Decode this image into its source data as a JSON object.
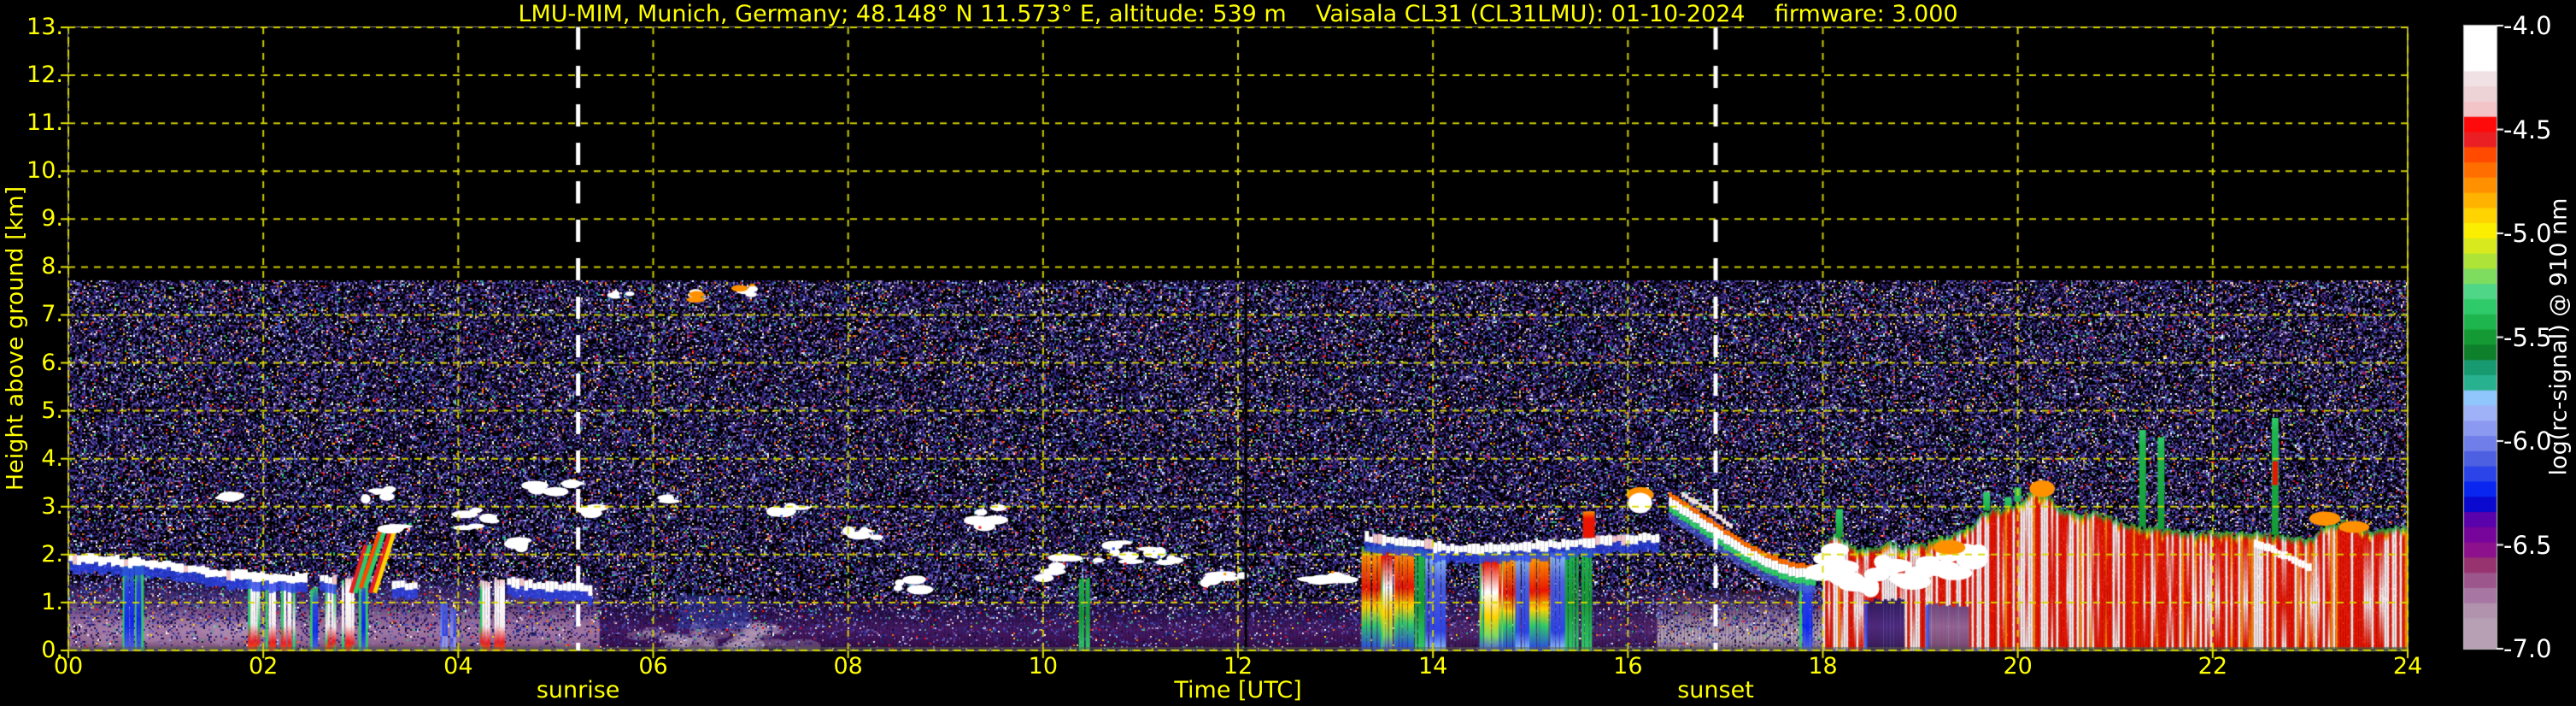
{
  "header": {
    "title": "LMU-MIM, Munich, Germany; 48.148° N 11.573° E, altitude: 539 m    Vaisala CL31 (CL31LMU): 01-10-2024    firmware: 3.000"
  },
  "chart_data": {
    "type": "heatmap",
    "title": "LMU-MIM, Munich, Germany; 48.148° N 11.573° E, altitude: 539 m    Vaisala CL31 (CL31LMU): 01-10-2024    firmware: 3.000",
    "xlabel": "Time [UTC]",
    "ylabel": "Height above ground [km]",
    "xlim": [
      0,
      24
    ],
    "ylim": [
      0,
      13
    ],
    "xticks": {
      "values": [
        0,
        2,
        4,
        6,
        8,
        10,
        12,
        14,
        16,
        18,
        20,
        22,
        24
      ],
      "labels": [
        "00",
        "02",
        "04",
        "06",
        "08",
        "10",
        "12",
        "14",
        "16",
        "18",
        "20",
        "22",
        "24"
      ]
    },
    "yticks": {
      "values": [
        0,
        1,
        2,
        3,
        4,
        5,
        6,
        7,
        8,
        9,
        10,
        11,
        12,
        13
      ],
      "labels": [
        "0.",
        "1.",
        "2.",
        "3.",
        "4.",
        "5.",
        "6.",
        "7.",
        "8.",
        "9.",
        "10.",
        "11.",
        "12.",
        "13."
      ]
    },
    "grid": {
      "color": "#d8d800",
      "style": "dashed",
      "x_interval_h": 2,
      "y_interval_km": 1,
      "above_data": true
    },
    "colorbar": {
      "label": "log(rc-signal) @ 910 nm",
      "min": -7.0,
      "max": -4.0,
      "ticks": [
        -4.0,
        -4.5,
        -5.0,
        -5.5,
        -6.0,
        -6.5,
        -7.0
      ],
      "tick_labels": [
        "-4.0",
        "-4.5",
        "-5.0",
        "-5.5",
        "-6.0",
        "-6.5",
        "-7.0"
      ],
      "palette_top_to_bottom": [
        "#ffffff",
        "#ffffff",
        "#ffffff",
        "#f0e2e4",
        "#eed3d6",
        "#f2c4c8",
        "#ff0a0a",
        "#ea1f24",
        "#ff4a00",
        "#ff6f00",
        "#ff9100",
        "#ffb300",
        "#ffd400",
        "#fcee00",
        "#d8ea1e",
        "#aee437",
        "#7edd5f",
        "#4fd687",
        "#2fca69",
        "#1fb54e",
        "#149a35",
        "#0e7f2b",
        "#189a70",
        "#28b18f",
        "#8fc6fb",
        "#9fb2f7",
        "#8c99f1",
        "#707ee9",
        "#4c60e1",
        "#2b44ea",
        "#0826f0",
        "#0909cf",
        "#5a02ab",
        "#77059b",
        "#8d108d",
        "#97336f",
        "#9c568b",
        "#a876a2",
        "#b193ae",
        "#b7a0b4",
        "#b7a0b4"
      ]
    },
    "sun": {
      "sunrise_label": "sunrise",
      "sunrise_utc": 5.23,
      "sunset_label": "sunset",
      "sunset_utc": 16.9,
      "line_color": "#ffffff"
    },
    "max_range_km": 7.72,
    "noise": {
      "dark": [
        "#1b0f3a",
        "#241457",
        "#2c1a6e",
        "#201046",
        "#35206e",
        "#3a1b5e",
        "#13082b",
        "#2a2a8a",
        "#1e2a7a",
        "#303a9e",
        "#4a2a8e",
        "#503a9a"
      ],
      "mid": [
        "#5560c0",
        "#6a4a9a",
        "#7a5aa6",
        "#4455bb",
        "#8f7ab0",
        "#9a86b8"
      ],
      "bright": [
        "#ffffff",
        "#f2c4c8",
        "#ff6f00",
        "#ffd400",
        "#2fca69",
        "#8fc6fb",
        "#ff0a0a",
        "#28b18f",
        "#9fb2f7",
        "#e8e8e8"
      ],
      "p_black": 0.42,
      "p_dark": 0.38,
      "p_mid": 0.13,
      "p_bright": 0.07
    },
    "regions": [
      {
        "t0": 0.0,
        "t1": 5.45,
        "stops": [
          [
            1.45,
            "#160a2e"
          ],
          [
            1.05,
            "#52356a"
          ],
          [
            0.7,
            "#8a5f8e"
          ],
          [
            0.4,
            "#a277a2"
          ],
          [
            0.15,
            "#8f648f"
          ],
          [
            0.0,
            "#5f3f63"
          ]
        ]
      },
      {
        "t0": 5.45,
        "t1": 13.25,
        "stops": [
          [
            1.1,
            "#130724"
          ],
          [
            0.75,
            "#2c1048"
          ],
          [
            0.45,
            "#471a62"
          ],
          [
            0.18,
            "#3c1254"
          ],
          [
            0.0,
            "#2a0c3e"
          ]
        ]
      },
      {
        "t0": 13.25,
        "t1": 16.3,
        "stops": [
          [
            1.3,
            "#150a28"
          ],
          [
            0.8,
            "#3a1a55"
          ],
          [
            0.4,
            "#55276e"
          ],
          [
            0.0,
            "#331048"
          ]
        ]
      },
      {
        "t0": 16.3,
        "t1": 18.0,
        "stops": [
          [
            1.25,
            "#241430"
          ],
          [
            0.9,
            "#6a4a70"
          ],
          [
            0.55,
            "#a28ba4"
          ],
          [
            0.25,
            "#b5a2b4"
          ],
          [
            0.08,
            "#8a6f8c"
          ],
          [
            0.0,
            "#5a3f5e"
          ]
        ]
      }
    ],
    "haze_patches": [
      {
        "t0": 5.8,
        "t1": 7.6,
        "h0": 0.08,
        "h1": 0.45,
        "color": "#c0abc0",
        "alpha": 0.5
      },
      {
        "t0": 0.1,
        "t1": 1.9,
        "h0": 0.2,
        "h1": 0.55,
        "color": "#b897b8",
        "alpha": 0.35
      }
    ],
    "blue_patches": [
      {
        "t0": 6.25,
        "t1": 7.0,
        "h0": 0.45,
        "h1": 1.15,
        "color": "#3050c8",
        "alpha": 0.45
      }
    ],
    "bl_lines": [
      {
        "points": [
          [
            0,
            1.93
          ],
          [
            0.35,
            1.88
          ],
          [
            0.7,
            1.83
          ],
          [
            1.0,
            1.78
          ],
          [
            1.3,
            1.68
          ],
          [
            1.6,
            1.6
          ],
          [
            1.85,
            1.56
          ],
          [
            2.05,
            1.52
          ],
          [
            2.3,
            1.5
          ],
          [
            2.45,
            1.5
          ]
        ]
      },
      {
        "points": [
          [
            2.58,
            1.5
          ],
          [
            2.75,
            1.48
          ]
        ]
      },
      {
        "points": [
          [
            3.32,
            1.38
          ],
          [
            3.55,
            1.33
          ]
        ]
      },
      {
        "points": [
          [
            4.5,
            1.42
          ],
          [
            4.7,
            1.38
          ],
          [
            4.95,
            1.34
          ],
          [
            5.2,
            1.3
          ],
          [
            5.35,
            1.28
          ]
        ]
      },
      {
        "points": [
          [
            13.3,
            2.35
          ],
          [
            13.6,
            2.28
          ],
          [
            13.9,
            2.2
          ],
          [
            14.2,
            2.12
          ],
          [
            14.5,
            2.1
          ],
          [
            14.8,
            2.15
          ],
          [
            15.1,
            2.2
          ],
          [
            15.4,
            2.22
          ],
          [
            15.7,
            2.3
          ],
          [
            16.0,
            2.33
          ],
          [
            16.3,
            2.35
          ]
        ]
      }
    ],
    "clouds": [
      {
        "t0": 1.6,
        "t1": 1.75,
        "h0": 3.05,
        "h1": 3.25
      },
      {
        "t0": 2.9,
        "t1": 3.3,
        "h0": 2.9,
        "h1": 3.4
      },
      {
        "t0": 3.3,
        "t1": 3.45,
        "h0": 2.5,
        "h1": 2.65
      },
      {
        "t0": 4.0,
        "t1": 4.4,
        "h0": 2.5,
        "h1": 3.0
      },
      {
        "t0": 4.55,
        "t1": 4.65,
        "h0": 2.15,
        "h1": 2.3
      },
      {
        "t0": 4.75,
        "t1": 5.2,
        "h0": 3.25,
        "h1": 3.5
      },
      {
        "t0": 5.3,
        "t1": 5.45,
        "h0": 2.85,
        "h1": 3.0
      },
      {
        "t0": 6.1,
        "t1": 6.18,
        "h0": 3.1,
        "h1": 3.2
      },
      {
        "t0": 7.2,
        "t1": 7.5,
        "h0": 2.85,
        "h1": 3.0
      },
      {
        "t0": 8.0,
        "t1": 8.3,
        "h0": 2.3,
        "h1": 2.55
      },
      {
        "t0": 8.5,
        "t1": 8.8,
        "h0": 1.25,
        "h1": 1.5
      },
      {
        "t0": 9.3,
        "t1": 9.6,
        "h0": 2.55,
        "h1": 3.0
      },
      {
        "t0": 10.0,
        "t1": 10.3,
        "h0": 1.5,
        "h1": 1.95
      },
      {
        "t0": 10.55,
        "t1": 11.4,
        "h0": 1.8,
        "h1": 2.25
      },
      {
        "t0": 11.6,
        "t1": 12.1,
        "h0": 1.4,
        "h1": 1.65
      },
      {
        "t0": 12.6,
        "t1": 13.1,
        "h0": 1.45,
        "h1": 1.6
      }
    ],
    "high_specks": [
      {
        "t0": 5.55,
        "t1": 5.78,
        "h": 7.45
      },
      {
        "t0": 6.4,
        "t1": 6.45,
        "h": 7.4
      },
      {
        "t0": 6.88,
        "t1": 7.12,
        "h": 7.5
      }
    ],
    "showers": [
      {
        "t": 0.62,
        "w": 16,
        "top": 1.85,
        "style": "gb"
      },
      {
        "t": 0.72,
        "w": 10,
        "top": 1.8,
        "style": "gb"
      },
      {
        "t": 1.9,
        "w": 14,
        "top": 1.55,
        "style": "wr"
      },
      {
        "t": 2.08,
        "w": 12,
        "top": 1.5,
        "style": "wr"
      },
      {
        "t": 2.25,
        "w": 14,
        "top": 1.52,
        "style": "wr"
      },
      {
        "t": 2.52,
        "w": 8,
        "top": 1.3,
        "style": "gb"
      },
      {
        "t": 2.68,
        "w": 10,
        "top": 1.45,
        "style": "wr"
      },
      {
        "t": 2.87,
        "w": 14,
        "top": 1.5,
        "style": "wr"
      },
      {
        "t": 3.02,
        "w": 10,
        "top": 1.6,
        "style": "gb"
      },
      {
        "t": 3.85,
        "w": 8,
        "top": 1.0,
        "style": "b"
      },
      {
        "t": 3.95,
        "w": 6,
        "top": 0.9,
        "style": "b"
      },
      {
        "t": 4.28,
        "w": 12,
        "top": 1.45,
        "style": "wr"
      },
      {
        "t": 4.42,
        "w": 12,
        "top": 1.5,
        "style": "wr"
      },
      {
        "t": 10.42,
        "w": 10,
        "top": 1.5,
        "style": "green"
      },
      {
        "t": 13.38,
        "w": 26,
        "top": 2.15,
        "style": "heavy"
      },
      {
        "t": 13.55,
        "w": 20,
        "top": 2.2,
        "style": "heavy2"
      },
      {
        "t": 13.7,
        "w": 22,
        "top": 2.2,
        "style": "heavy"
      },
      {
        "t": 13.88,
        "w": 14,
        "top": 2.1,
        "style": "green"
      },
      {
        "t": 14.0,
        "w": 16,
        "top": 2.05,
        "style": "bluecol"
      },
      {
        "t": 14.07,
        "w": 10,
        "top": 2.0,
        "style": "bluecol"
      },
      {
        "t": 14.6,
        "w": 30,
        "top": 2.05,
        "style": "heavy2"
      },
      {
        "t": 14.78,
        "w": 22,
        "top": 2.0,
        "style": "heavy"
      },
      {
        "t": 14.95,
        "w": 22,
        "top": 2.0,
        "style": "bluecol"
      },
      {
        "t": 15.1,
        "w": 26,
        "top": 2.05,
        "style": "heavy"
      },
      {
        "t": 15.28,
        "w": 18,
        "top": 2.05,
        "style": "bluecol"
      },
      {
        "t": 15.42,
        "w": 14,
        "top": 2.1,
        "style": "green"
      },
      {
        "t": 15.58,
        "w": 12,
        "top": 2.1,
        "style": "green"
      },
      {
        "t": 17.82,
        "w": 14,
        "top": 1.6,
        "style": "gb"
      }
    ],
    "diag_streaks": [
      {
        "p0": [
          2.9,
          1.2
        ],
        "p1": [
          3.05,
          2.2
        ],
        "colors": [
          "#ea1f24",
          "#2fca69"
        ]
      },
      {
        "p0": [
          3.0,
          1.3
        ],
        "p1": [
          3.2,
          2.5
        ],
        "colors": [
          "#ff4a00",
          "#2fca69"
        ]
      },
      {
        "p0": [
          3.1,
          1.2
        ],
        "p1": [
          3.32,
          2.6
        ],
        "colors": [
          "#ea1f24",
          "#ffd400"
        ]
      }
    ],
    "red_spike": {
      "t": 15.6,
      "h0": 2.35,
      "h1": 2.9,
      "w": 14
    },
    "white_blob_16": {
      "t0": 16.05,
      "t1": 16.2,
      "h0": 2.9,
      "h1": 3.25
    },
    "descending_streak": {
      "points": [
        [
          16.42,
          3.08
        ],
        [
          16.6,
          2.85
        ],
        [
          16.8,
          2.6
        ],
        [
          17.0,
          2.3
        ],
        [
          17.2,
          2.05
        ],
        [
          17.45,
          1.8
        ],
        [
          17.7,
          1.62
        ],
        [
          17.9,
          1.58
        ]
      ],
      "secondary": [
        [
          16.55,
          3.25
        ],
        [
          16.8,
          2.95
        ],
        [
          17.05,
          2.6
        ]
      ]
    },
    "data_gaps": [
      {
        "t": 12.08
      }
    ],
    "storm": {
      "t0": 18.0,
      "t1": 24.0,
      "top_profile": [
        [
          18.0,
          2.1
        ],
        [
          18.1,
          2.5
        ],
        [
          18.2,
          2.3
        ],
        [
          18.35,
          2.15
        ],
        [
          18.5,
          2.1
        ],
        [
          18.65,
          2.25
        ],
        [
          18.8,
          2.15
        ],
        [
          19.0,
          2.2
        ],
        [
          19.2,
          2.35
        ],
        [
          19.4,
          2.45
        ],
        [
          19.55,
          2.7
        ],
        [
          19.7,
          2.95
        ],
        [
          19.85,
          2.95
        ],
        [
          20.0,
          3.1
        ],
        [
          20.15,
          3.3
        ],
        [
          20.3,
          3.2
        ],
        [
          20.45,
          2.95
        ],
        [
          20.6,
          2.85
        ],
        [
          20.75,
          2.9
        ],
        [
          20.9,
          2.8
        ],
        [
          21.05,
          2.7
        ],
        [
          21.2,
          2.6
        ],
        [
          21.4,
          2.55
        ],
        [
          21.6,
          2.5
        ],
        [
          21.8,
          2.45
        ],
        [
          22.0,
          2.5
        ],
        [
          22.2,
          2.42
        ],
        [
          22.4,
          2.48
        ],
        [
          22.6,
          2.42
        ],
        [
          22.8,
          2.38
        ],
        [
          23.0,
          2.35
        ],
        [
          23.15,
          2.6
        ],
        [
          23.3,
          2.7
        ],
        [
          23.45,
          2.6
        ],
        [
          23.6,
          2.5
        ],
        [
          23.75,
          2.55
        ],
        [
          23.9,
          2.6
        ],
        [
          24.0,
          2.55
        ]
      ],
      "spikes": [
        {
          "t": 18.17,
          "h": 2.95
        },
        {
          "t": 19.68,
          "h": 3.3
        },
        {
          "t": 19.9,
          "h": 3.2
        },
        {
          "t": 20.0,
          "h": 3.4
        },
        {
          "t": 21.28,
          "h": 4.6
        },
        {
          "t": 21.47,
          "h": 4.45
        },
        {
          "t": 22.64,
          "h": 4.85,
          "red_tip": true
        }
      ],
      "gaps": [
        {
          "t0": 18.45,
          "t1": 18.82,
          "htop": 1.05,
          "stops": [
            [
              1.05,
              "#2c1a5e"
            ],
            [
              0.5,
              "#4a2a80"
            ],
            [
              0.15,
              "#3a2064"
            ],
            [
              0.0,
              "#2a1650"
            ]
          ]
        },
        {
          "t0": 19.08,
          "t1": 19.5,
          "htop": 0.95,
          "stops": [
            [
              0.95,
              "#6a4880"
            ],
            [
              0.5,
              "#8f6699"
            ],
            [
              0.15,
              "#7a527f"
            ],
            [
              0.0,
              "#5e3a66"
            ]
          ]
        }
      ],
      "white_streak": [
        [
          22.42,
          2.25
        ],
        [
          22.7,
          2.0
        ],
        [
          23.0,
          1.7
        ]
      ],
      "orange_blobs": [
        {
          "t": 23.15,
          "h0": 2.6,
          "h1": 2.9
        },
        {
          "t": 23.45,
          "h0": 2.45,
          "h1": 2.7
        },
        {
          "t": 19.3,
          "h0": 2.0,
          "h1": 2.3
        },
        {
          "t": 20.25,
          "h0": 3.2,
          "h1": 3.55
        }
      ],
      "ground_green_from": 20.3
    }
  }
}
